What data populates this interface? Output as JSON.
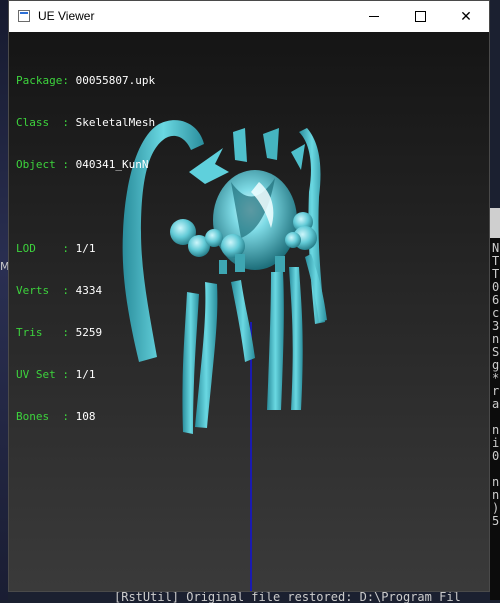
{
  "window": {
    "title": "UE Viewer",
    "minimize_label": "—",
    "maximize_label": "☐",
    "close_label": "✕"
  },
  "info": {
    "package": {
      "key": "Package: ",
      "value": "00055807.upk"
    },
    "class": {
      "key": "Class  : ",
      "value": "SkeletalMesh"
    },
    "object": {
      "key": "Object : ",
      "value": "040341_KunN"
    },
    "lod": {
      "key": "LOD    : ",
      "value": "1/1"
    },
    "verts": {
      "key": "Verts  : ",
      "value": "4334"
    },
    "tris": {
      "key": "Tris   : ",
      "value": "5259"
    },
    "uvset": {
      "key": "UV Set : ",
      "value": "1/1"
    },
    "bones": {
      "key": "Bones  : ",
      "value": "108"
    }
  },
  "console": {
    "lines": [
      "N",
      "T",
      "T",
      "0",
      "6",
      "c",
      "3",
      "n",
      "S",
      "g",
      "*",
      "r",
      "a",
      "",
      "n",
      "i",
      "0",
      "",
      "n",
      "n",
      ")",
      "5"
    ],
    "bottom": "[RstUtil] Original file restored: D:\\Program Fil"
  },
  "desktop": {
    "glyph": "M"
  },
  "colors": {
    "mesh": "#5fd0dc",
    "mesh_dark": "#2a8d9c",
    "info_key": "#3dd33d",
    "axis": "#1a1ab0"
  }
}
